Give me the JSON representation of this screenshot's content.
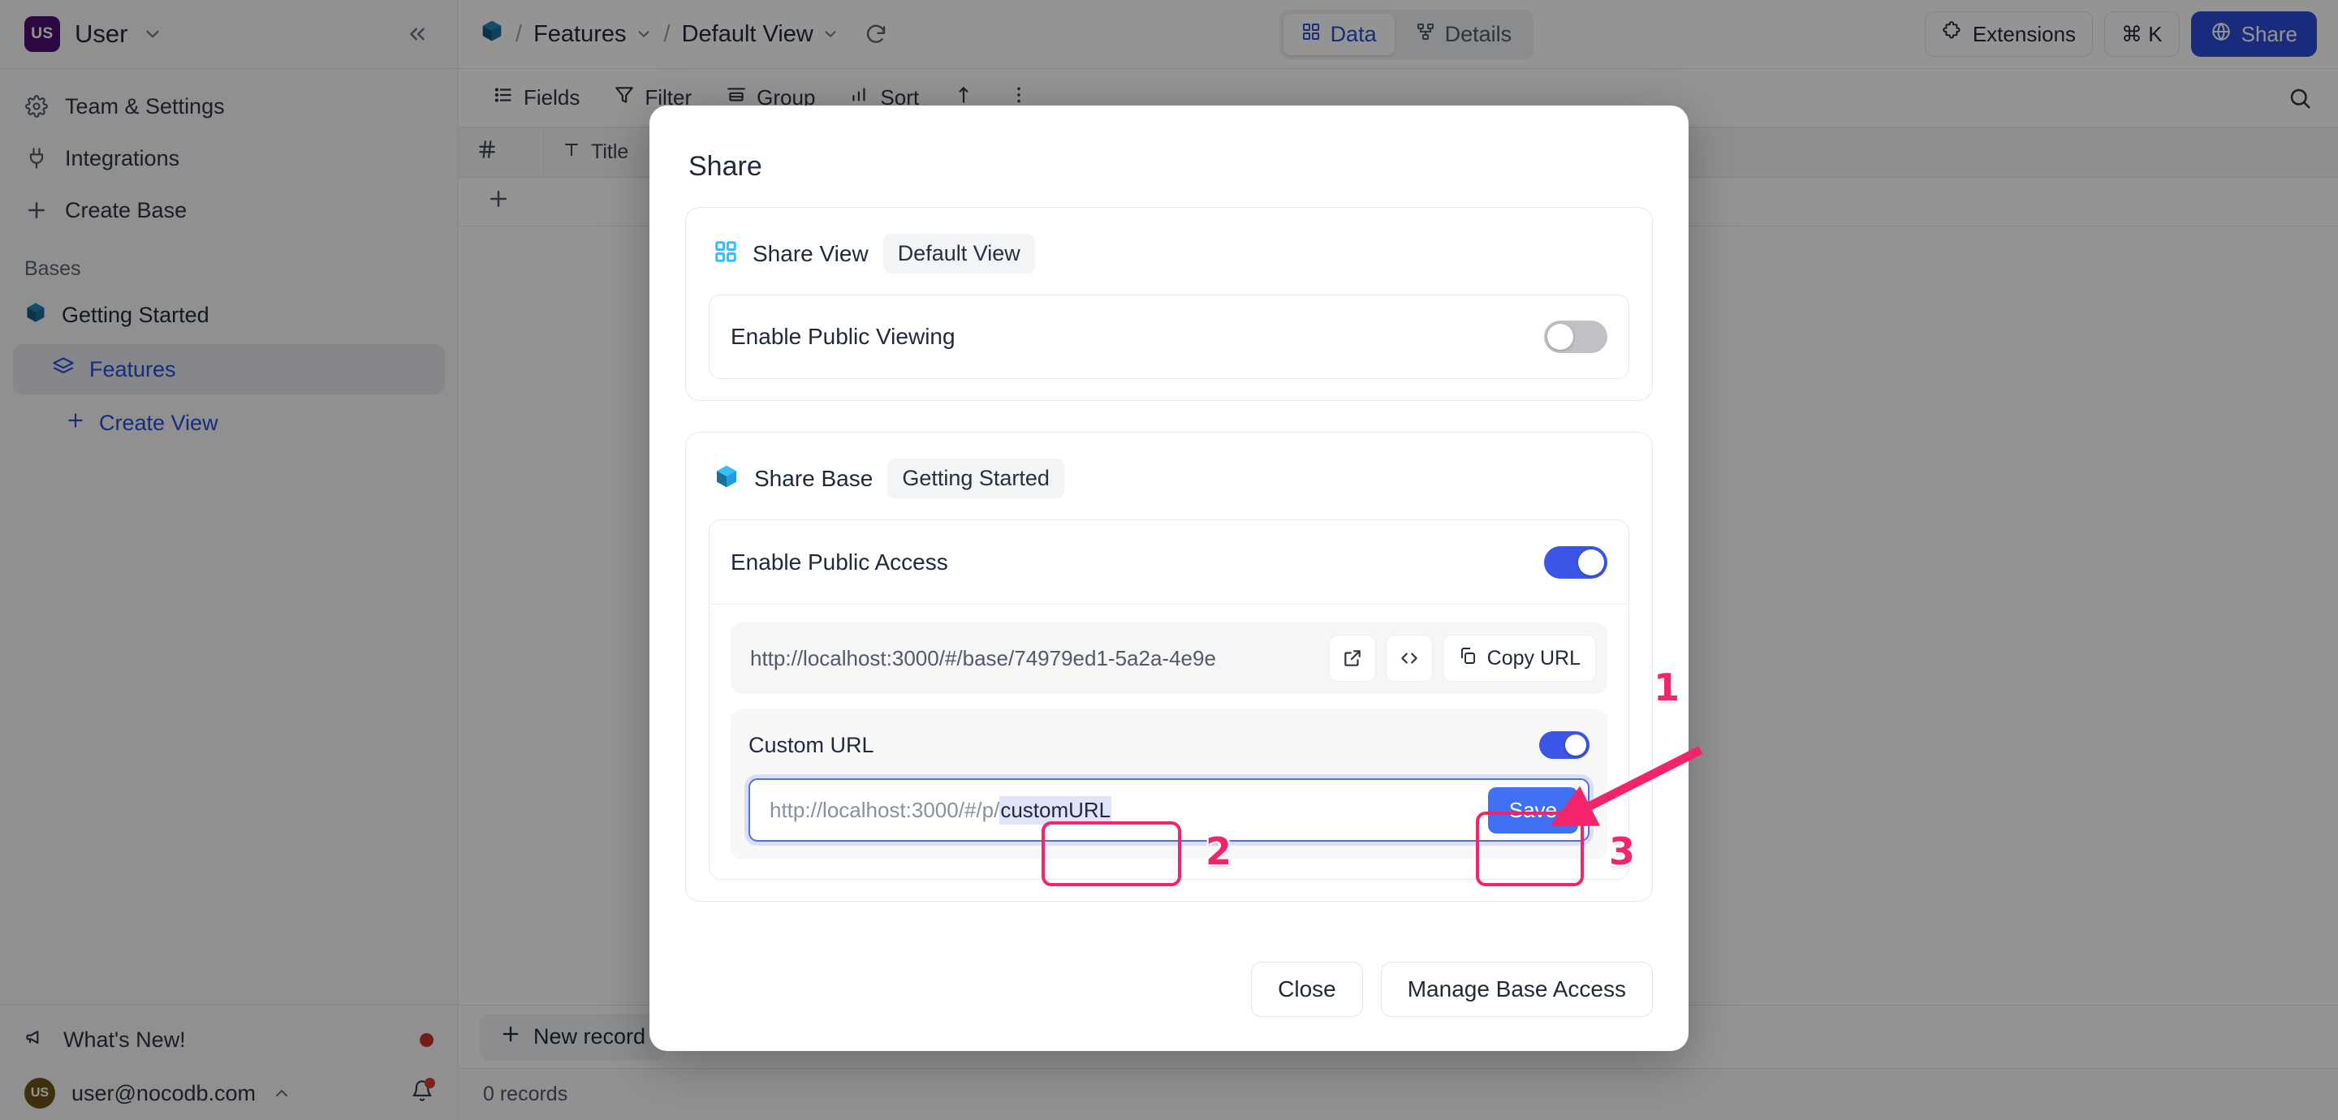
{
  "sidebar": {
    "workspace": {
      "initials": "US",
      "name": "User"
    },
    "nav": [
      {
        "label": "Team & Settings",
        "icon": "gear-icon"
      },
      {
        "label": "Integrations",
        "icon": "plug-icon"
      },
      {
        "label": "Create Base",
        "icon": "plus-icon"
      }
    ],
    "bases_label": "Bases",
    "base": {
      "label": "Getting Started"
    },
    "table": {
      "label": "Features"
    },
    "create_view": {
      "label": "Create View"
    },
    "whats_new": {
      "label": "What's New!"
    },
    "user_email": "user@nocodb.com"
  },
  "topbar": {
    "breadcrumb": [
      {
        "label": "Features"
      },
      {
        "label": "Default View"
      }
    ],
    "tabs": [
      {
        "label": "Data",
        "active": true
      },
      {
        "label": "Details",
        "active": false
      }
    ],
    "extensions_label": "Extensions",
    "command_label": "⌘ K",
    "share_label": "Share"
  },
  "toolbar": {
    "items": [
      {
        "label": "Fields",
        "icon": "fields-icon"
      },
      {
        "label": "Filter",
        "icon": "filter-icon"
      },
      {
        "label": "Group",
        "icon": "group-icon"
      },
      {
        "label": "Sort",
        "icon": "sort-icon"
      }
    ],
    "row_height_icon": "row-height-icon",
    "more_icon": "more-vertical-icon",
    "search_icon": "search-icon"
  },
  "grid": {
    "columns": [
      {
        "label": "",
        "icon": "hash-icon"
      },
      {
        "label": "Title",
        "icon": "text-icon"
      }
    ],
    "add_row_icon": "plus-icon",
    "new_record_label": "New record",
    "records_count": "0 records"
  },
  "modal": {
    "title": "Share",
    "share_view": {
      "label": "Share View",
      "chip": "Default View",
      "public_viewing_label": "Enable Public Viewing",
      "public_viewing_on": false
    },
    "share_base": {
      "label": "Share Base",
      "chip": "Getting Started",
      "public_access_label": "Enable Public Access",
      "public_access_on": true,
      "url": "http://localhost:3000/#/base/74979ed1-5a2a-4e9e",
      "open_icon": "external-link-icon",
      "embed_icon": "code-icon",
      "copy_label": "Copy URL",
      "custom_url_label": "Custom URL",
      "custom_url_on": true,
      "custom_url_prefix": "http://localhost:3000/#/p/",
      "custom_url_value": "customURL",
      "save_label": "Save"
    },
    "footer": {
      "close_label": "Close",
      "manage_label": "Manage Base Access"
    }
  },
  "annotations": {
    "color": "#f4246b",
    "markers": [
      {
        "id": "1",
        "target": "custom-url-toggle"
      },
      {
        "id": "2",
        "target": "custom-url-value"
      },
      {
        "id": "3",
        "target": "save-button"
      }
    ]
  },
  "colors": {
    "accent": "#2b4ad6",
    "toggle_on": "#3b55e6",
    "save_button": "#4270f4",
    "annotation": "#f4246b",
    "avatar": "#4a0f72"
  }
}
